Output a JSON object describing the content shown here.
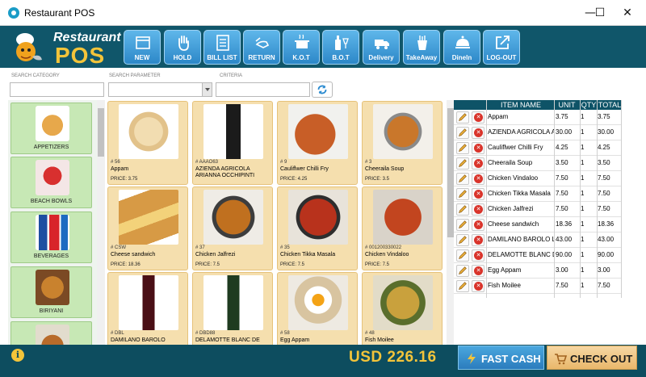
{
  "window": {
    "title": "Restaurant POS",
    "minimize": "—",
    "maximize": "☐",
    "close": "✕"
  },
  "logo": {
    "line1": "Restaurant",
    "line2": "POS"
  },
  "toolbar": [
    {
      "label": "NEW",
      "icon": "new-icon"
    },
    {
      "label": "HOLD",
      "icon": "hand-icon"
    },
    {
      "label": "BILL LIST",
      "icon": "bill-list-icon"
    },
    {
      "label": "RETURN",
      "icon": "return-icon"
    },
    {
      "label": "K.O.T",
      "icon": "cooking-pot-icon"
    },
    {
      "label": "B.O.T",
      "icon": "bottle-icon"
    },
    {
      "label": "Delivery",
      "icon": "delivery-truck-icon"
    },
    {
      "label": "TakeAway",
      "icon": "takeaway-icon"
    },
    {
      "label": "DineIn",
      "icon": "dine-in-icon"
    },
    {
      "label": "LOG-OUT",
      "icon": "logout-icon"
    }
  ],
  "search": {
    "category_label": "SEARCH CATEGORY",
    "parameter_label": "SEARCH PARAMETER",
    "criteria_label": "CRITERIA",
    "category_value": "",
    "parameter_value": "",
    "criteria_value": ""
  },
  "categories": [
    {
      "label": "APPETIZERS"
    },
    {
      "label": "BEACH BOWLS"
    },
    {
      "label": "BEVERAGES"
    },
    {
      "label": "BIRIYANI"
    },
    {
      "label": ""
    }
  ],
  "items": [
    {
      "code": "# 56",
      "name": "Appam",
      "price": "PRICE: 3.75"
    },
    {
      "code": "# AAAO63",
      "name": "AZIENDA AGRICOLA ARIANNA OCCHIPINTI SArianna",
      "price": ""
    },
    {
      "code": "# 9",
      "name": "Cauliflwer Chilli Fry",
      "price": "PRICE: 4.25"
    },
    {
      "code": "# 3",
      "name": "Cheeraila Soup",
      "price": "PRICE: 3.5"
    },
    {
      "code": "# CSW",
      "name": "Cheese sandwich",
      "price": "PRICE: 18.36"
    },
    {
      "code": "# 37",
      "name": "Chicken Jalfrezi",
      "price": "PRICE: 7.5"
    },
    {
      "code": "# 35",
      "name": "Chicken Tikka Masala",
      "price": "PRICE: 7.5"
    },
    {
      "code": "# 001200330022",
      "name": "Chicken Vindaloo",
      "price": "PRICE: 7.5"
    },
    {
      "code": "# DBL",
      "name": "DAMILANO BAROLO",
      "price": ""
    },
    {
      "code": "# DBD88",
      "name": "DELAMOTTE BLANC DE",
      "price": ""
    },
    {
      "code": "# 58",
      "name": "Egg Appam",
      "price": ""
    },
    {
      "code": "# 48",
      "name": "Fish Moilee",
      "price": ""
    }
  ],
  "order": {
    "headers": {
      "name": "ITEM NAME",
      "unit": "UNIT",
      "qty": "QTY",
      "total": "TOTAL"
    },
    "rows": [
      {
        "name": "Appam",
        "unit": "3.75",
        "qty": "1",
        "total": "3.75"
      },
      {
        "name": "AZIENDA AGRICOLA ARIANNA",
        "unit": "30.00",
        "qty": "1",
        "total": "30.00"
      },
      {
        "name": "Cauliflwer Chilli Fry",
        "unit": "4.25",
        "qty": "1",
        "total": "4.25"
      },
      {
        "name": "Cheeraila Soup",
        "unit": "3.50",
        "qty": "1",
        "total": "3.50"
      },
      {
        "name": "Chicken Vindaloo",
        "unit": "7.50",
        "qty": "1",
        "total": "7.50"
      },
      {
        "name": "Chicken Tikka Masala",
        "unit": "7.50",
        "qty": "1",
        "total": "7.50"
      },
      {
        "name": "Chicken Jalfrezi",
        "unit": "7.50",
        "qty": "1",
        "total": "7.50"
      },
      {
        "name": "Cheese sandwich",
        "unit": "18.36",
        "qty": "1",
        "total": "18.36"
      },
      {
        "name": "DAMILANO BAROLO LE",
        "unit": "43.00",
        "qty": "1",
        "total": "43.00"
      },
      {
        "name": "DELAMOTTE BLANC DE",
        "unit": "90.00",
        "qty": "1",
        "total": "90.00"
      },
      {
        "name": "Egg Appam",
        "unit": "3.00",
        "qty": "1",
        "total": "3.00"
      },
      {
        "name": "Fish Moilee",
        "unit": "7.50",
        "qty": "1",
        "total": "7.50"
      }
    ]
  },
  "footer": {
    "info": "i",
    "total": "USD  226.16",
    "fast_cash": "FAST CASH",
    "checkout": "CHECK OUT"
  },
  "colors": {
    "header": "#10566a",
    "accent_yellow": "#f3c43a",
    "toolbar_blue": "#2c87c8",
    "item_tile": "#f5dfae",
    "category_tile": "#c7e8b5"
  }
}
